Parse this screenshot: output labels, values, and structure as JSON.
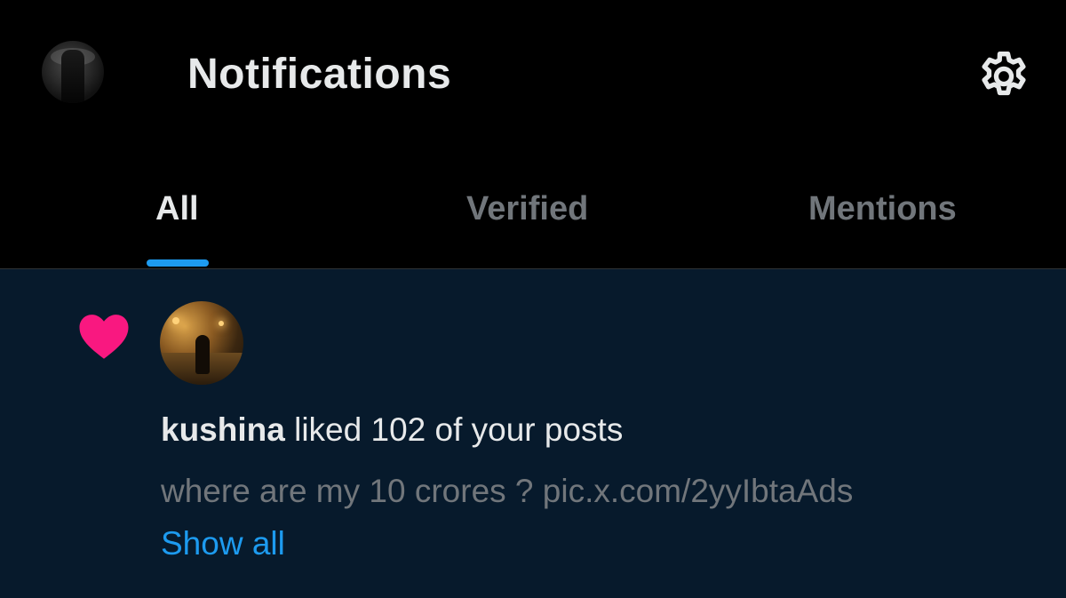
{
  "header": {
    "title": "Notifications",
    "settings_icon": "gear-icon"
  },
  "tabs": [
    {
      "label": "All",
      "active": true
    },
    {
      "label": "Verified",
      "active": false
    },
    {
      "label": "Mentions",
      "active": false
    }
  ],
  "notification": {
    "type_icon": "heart-icon",
    "user": "kushina",
    "action": "liked 102 of your posts",
    "preview": "where are my 10 crores ? pic.x.com/2yyIbtaAds",
    "show_all": "Show all"
  },
  "colors": {
    "background": "#000000",
    "notification_bg": "#071a2c",
    "accent": "#1d9bf0",
    "like": "#f91880",
    "text_primary": "#e7e9ea",
    "text_secondary": "#71767b"
  }
}
